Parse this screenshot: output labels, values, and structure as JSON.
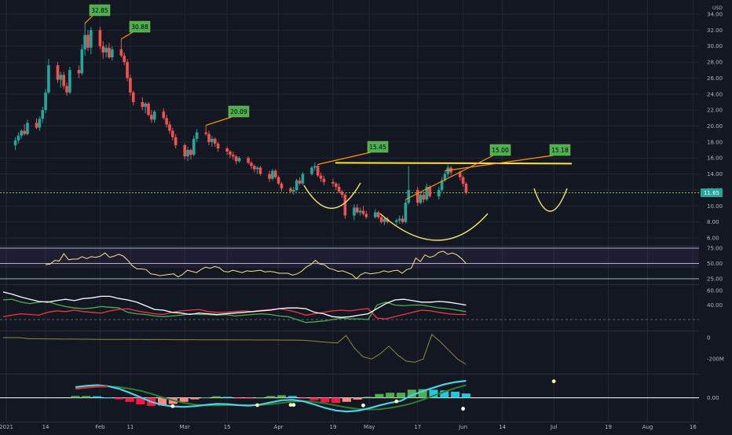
{
  "chart_data": {
    "type": "candlestick",
    "currency": "USD",
    "last_price": "11.65",
    "price_axis": {
      "min": 6,
      "max": 34,
      "ticks": [
        "34.00",
        "32.00",
        "30.00",
        "28.00",
        "26.00",
        "24.00",
        "22.00",
        "20.00",
        "18.00",
        "16.00",
        "14.00",
        "12.00",
        "10.00",
        "8.00",
        "6.00"
      ]
    },
    "x_ticks": [
      "2021",
      "14",
      "Feb",
      "11",
      "Mar",
      "15",
      "Apr",
      "19",
      "May",
      "17",
      "Jun",
      "14",
      "Jul",
      "19",
      "Aug",
      "16"
    ],
    "annotations": [
      "32.85",
      "30.88",
      "20.09",
      "15.45",
      "15.00",
      "15.18"
    ],
    "resistance_level": 15.4,
    "candles": [
      {
        "o": 17.6,
        "h": 18.6,
        "l": 17.0,
        "c": 18.2
      },
      {
        "o": 18.2,
        "h": 19.2,
        "l": 17.8,
        "c": 18.8
      },
      {
        "o": 18.8,
        "h": 19.6,
        "l": 18.4,
        "c": 19.4
      },
      {
        "o": 19.4,
        "h": 20.2,
        "l": 18.8,
        "c": 19.0
      },
      {
        "o": 19.0,
        "h": 20.8,
        "l": 18.8,
        "c": 20.4
      },
      {
        "o": 20.4,
        "h": 21.0,
        "l": 19.6,
        "c": 19.8
      },
      {
        "o": 19.8,
        "h": 21.2,
        "l": 19.4,
        "c": 20.9
      },
      {
        "o": 20.9,
        "h": 22.4,
        "l": 20.4,
        "c": 22.0
      },
      {
        "o": 22.0,
        "h": 24.6,
        "l": 21.6,
        "c": 24.2
      },
      {
        "o": 24.2,
        "h": 28.4,
        "l": 24.0,
        "c": 27.6
      },
      {
        "o": 27.6,
        "h": 28.0,
        "l": 25.4,
        "c": 25.8
      },
      {
        "o": 25.8,
        "h": 26.8,
        "l": 24.8,
        "c": 26.4
      },
      {
        "o": 26.4,
        "h": 26.8,
        "l": 24.6,
        "c": 25.0
      },
      {
        "o": 25.0,
        "h": 25.4,
        "l": 23.8,
        "c": 24.2
      },
      {
        "o": 24.2,
        "h": 27.4,
        "l": 24.0,
        "c": 27.0
      },
      {
        "o": 27.0,
        "h": 27.6,
        "l": 26.0,
        "c": 26.6
      },
      {
        "o": 26.6,
        "h": 30.2,
        "l": 26.4,
        "c": 29.6
      },
      {
        "o": 29.6,
        "h": 32.85,
        "l": 28.8,
        "c": 31.4
      },
      {
        "o": 31.4,
        "h": 32.0,
        "l": 29.4,
        "c": 29.8
      },
      {
        "o": 29.8,
        "h": 32.4,
        "l": 29.0,
        "c": 32.0
      },
      {
        "o": 32.0,
        "h": 32.4,
        "l": 29.6,
        "c": 30.0
      },
      {
        "o": 30.0,
        "h": 30.6,
        "l": 28.4,
        "c": 29.2
      },
      {
        "o": 29.2,
        "h": 30.2,
        "l": 28.6,
        "c": 29.8
      },
      {
        "o": 29.8,
        "h": 30.4,
        "l": 28.4,
        "c": 28.6
      },
      {
        "o": 28.6,
        "h": 30.0,
        "l": 28.2,
        "c": 29.6
      },
      {
        "o": 29.6,
        "h": 30.88,
        "l": 28.6,
        "c": 28.8
      },
      {
        "o": 28.8,
        "h": 29.2,
        "l": 27.6,
        "c": 28.0
      },
      {
        "o": 28.0,
        "h": 28.4,
        "l": 25.6,
        "c": 26.0
      },
      {
        "o": 26.0,
        "h": 26.4,
        "l": 23.8,
        "c": 24.2
      },
      {
        "o": 24.2,
        "h": 24.4,
        "l": 22.6,
        "c": 23.0
      },
      {
        "o": 23.0,
        "h": 23.6,
        "l": 22.0,
        "c": 22.4
      },
      {
        "o": 22.4,
        "h": 23.0,
        "l": 21.6,
        "c": 22.8
      },
      {
        "o": 22.8,
        "h": 23.0,
        "l": 21.2,
        "c": 21.4
      },
      {
        "o": 21.4,
        "h": 22.0,
        "l": 20.4,
        "c": 20.8
      },
      {
        "o": 20.8,
        "h": 22.0,
        "l": 20.4,
        "c": 21.8
      },
      {
        "o": 21.8,
        "h": 22.2,
        "l": 20.8,
        "c": 21.0
      },
      {
        "o": 21.0,
        "h": 21.4,
        "l": 19.8,
        "c": 20.2
      },
      {
        "o": 20.2,
        "h": 20.6,
        "l": 19.0,
        "c": 19.4
      },
      {
        "o": 19.4,
        "h": 19.8,
        "l": 18.2,
        "c": 18.6
      },
      {
        "o": 18.6,
        "h": 19.0,
        "l": 17.2,
        "c": 17.6
      },
      {
        "o": 17.6,
        "h": 17.8,
        "l": 15.8,
        "c": 16.2
      },
      {
        "o": 16.2,
        "h": 17.4,
        "l": 15.6,
        "c": 17.0
      },
      {
        "o": 17.0,
        "h": 17.2,
        "l": 15.8,
        "c": 16.4
      },
      {
        "o": 16.4,
        "h": 18.8,
        "l": 16.2,
        "c": 18.4
      },
      {
        "o": 18.4,
        "h": 19.6,
        "l": 18.0,
        "c": 19.2
      },
      {
        "o": 19.2,
        "h": 20.09,
        "l": 18.8,
        "c": 19.0
      },
      {
        "o": 19.0,
        "h": 19.4,
        "l": 17.6,
        "c": 18.0
      },
      {
        "o": 18.0,
        "h": 18.8,
        "l": 17.4,
        "c": 18.4
      },
      {
        "o": 18.4,
        "h": 18.6,
        "l": 17.4,
        "c": 17.8
      },
      {
        "o": 17.8,
        "h": 18.0,
        "l": 16.8,
        "c": 17.2
      },
      {
        "o": 17.2,
        "h": 17.4,
        "l": 16.4,
        "c": 16.8
      },
      {
        "o": 16.8,
        "h": 17.0,
        "l": 16.0,
        "c": 16.4
      },
      {
        "o": 16.4,
        "h": 16.8,
        "l": 15.8,
        "c": 16.2
      },
      {
        "o": 16.2,
        "h": 16.4,
        "l": 15.2,
        "c": 15.6
      },
      {
        "o": 15.6,
        "h": 16.2,
        "l": 15.4,
        "c": 16.0
      },
      {
        "o": 16.0,
        "h": 16.2,
        "l": 15.2,
        "c": 15.4
      },
      {
        "o": 15.4,
        "h": 15.6,
        "l": 14.6,
        "c": 15.0
      },
      {
        "o": 15.0,
        "h": 15.2,
        "l": 14.2,
        "c": 14.6
      },
      {
        "o": 14.6,
        "h": 15.0,
        "l": 14.0,
        "c": 14.8
      },
      {
        "o": 14.8,
        "h": 15.0,
        "l": 13.8,
        "c": 14.0
      },
      {
        "o": 14.0,
        "h": 14.4,
        "l": 13.0,
        "c": 13.4
      },
      {
        "o": 13.4,
        "h": 14.6,
        "l": 13.2,
        "c": 14.4
      },
      {
        "o": 14.4,
        "h": 14.6,
        "l": 13.4,
        "c": 13.6
      },
      {
        "o": 13.6,
        "h": 13.8,
        "l": 12.6,
        "c": 12.8
      },
      {
        "o": 12.8,
        "h": 13.0,
        "l": 11.8,
        "c": 12.2
      },
      {
        "o": 12.2,
        "h": 12.4,
        "l": 11.6,
        "c": 11.8
      },
      {
        "o": 11.8,
        "h": 12.4,
        "l": 11.4,
        "c": 12.0
      },
      {
        "o": 12.0,
        "h": 13.4,
        "l": 11.8,
        "c": 13.2
      },
      {
        "o": 13.2,
        "h": 13.6,
        "l": 12.6,
        "c": 12.8
      },
      {
        "o": 12.8,
        "h": 14.2,
        "l": 12.6,
        "c": 14.0
      },
      {
        "o": 14.0,
        "h": 15.0,
        "l": 13.8,
        "c": 14.8
      },
      {
        "o": 14.8,
        "h": 15.45,
        "l": 14.4,
        "c": 15.0
      },
      {
        "o": 15.0,
        "h": 15.2,
        "l": 13.6,
        "c": 13.8
      },
      {
        "o": 13.8,
        "h": 14.2,
        "l": 13.0,
        "c": 13.4
      },
      {
        "o": 13.4,
        "h": 13.8,
        "l": 12.6,
        "c": 13.0
      },
      {
        "o": 13.0,
        "h": 13.4,
        "l": 12.4,
        "c": 12.8
      },
      {
        "o": 12.8,
        "h": 13.0,
        "l": 12.0,
        "c": 12.4
      },
      {
        "o": 12.4,
        "h": 12.8,
        "l": 11.6,
        "c": 11.8
      },
      {
        "o": 11.8,
        "h": 12.0,
        "l": 11.0,
        "c": 11.4
      },
      {
        "o": 11.4,
        "h": 11.6,
        "l": 8.4,
        "c": 8.8
      },
      {
        "o": 8.8,
        "h": 10.2,
        "l": 8.2,
        "c": 9.8
      },
      {
        "o": 9.8,
        "h": 10.2,
        "l": 9.0,
        "c": 9.2
      },
      {
        "o": 9.2,
        "h": 9.8,
        "l": 8.8,
        "c": 9.4
      },
      {
        "o": 9.4,
        "h": 10.0,
        "l": 8.8,
        "c": 9.0
      },
      {
        "o": 9.0,
        "h": 9.4,
        "l": 8.4,
        "c": 8.6
      },
      {
        "o": 8.6,
        "h": 9.6,
        "l": 8.4,
        "c": 9.2
      },
      {
        "o": 9.2,
        "h": 9.4,
        "l": 8.4,
        "c": 8.6
      },
      {
        "o": 8.6,
        "h": 8.8,
        "l": 7.8,
        "c": 8.0
      },
      {
        "o": 8.0,
        "h": 8.6,
        "l": 7.6,
        "c": 8.4
      },
      {
        "o": 8.4,
        "h": 8.6,
        "l": 7.8,
        "c": 8.0
      },
      {
        "o": 8.0,
        "h": 8.4,
        "l": 7.6,
        "c": 8.2
      },
      {
        "o": 8.2,
        "h": 8.8,
        "l": 7.8,
        "c": 8.4
      },
      {
        "o": 8.4,
        "h": 8.8,
        "l": 7.8,
        "c": 8.0
      },
      {
        "o": 8.0,
        "h": 10.8,
        "l": 7.8,
        "c": 10.4
      },
      {
        "o": 10.4,
        "h": 15.0,
        "l": 10.2,
        "c": 12.0
      },
      {
        "o": 12.0,
        "h": 12.4,
        "l": 10.0,
        "c": 10.4
      },
      {
        "o": 10.4,
        "h": 11.8,
        "l": 10.2,
        "c": 11.4
      },
      {
        "o": 11.4,
        "h": 11.8,
        "l": 10.4,
        "c": 10.8
      },
      {
        "o": 10.8,
        "h": 12.8,
        "l": 10.6,
        "c": 12.4
      },
      {
        "o": 12.4,
        "h": 12.6,
        "l": 11.0,
        "c": 11.2
      },
      {
        "o": 11.2,
        "h": 12.4,
        "l": 10.8,
        "c": 12.0
      },
      {
        "o": 12.0,
        "h": 13.6,
        "l": 11.8,
        "c": 13.2
      },
      {
        "o": 13.2,
        "h": 14.4,
        "l": 13.0,
        "c": 14.0
      },
      {
        "o": 14.0,
        "h": 15.18,
        "l": 13.6,
        "c": 14.8
      },
      {
        "o": 14.8,
        "h": 15.0,
        "l": 13.8,
        "c": 14.2
      },
      {
        "o": 14.2,
        "h": 14.4,
        "l": 13.2,
        "c": 13.6
      },
      {
        "o": 13.6,
        "h": 13.8,
        "l": 12.4,
        "c": 12.8
      },
      {
        "o": 12.8,
        "h": 13.0,
        "l": 11.4,
        "c": 11.65
      }
    ],
    "rsi": {
      "levels": [
        "75.00",
        "50.00",
        "25.00"
      ],
      "values": [
        48,
        49,
        55,
        54,
        66,
        56,
        57,
        57,
        61,
        58,
        61,
        60,
        62,
        67,
        60,
        62,
        65,
        62,
        55,
        46,
        41,
        41,
        40,
        33,
        32,
        30,
        31,
        32,
        33,
        28,
        32,
        39,
        37,
        35,
        40,
        44,
        42,
        45,
        43,
        37,
        36,
        39,
        37,
        35,
        38,
        37,
        38,
        39,
        36,
        37,
        36,
        34,
        34,
        34,
        31,
        33,
        37,
        44,
        48,
        55,
        49,
        48,
        42,
        40,
        37,
        38,
        35,
        32,
        25,
        32,
        35,
        33,
        34,
        35,
        38,
        36,
        38,
        39,
        34,
        40,
        42,
        59,
        53,
        64,
        60,
        62,
        68,
        70,
        65,
        67,
        64,
        58,
        50
      ]
    },
    "dmi": {
      "levels": [
        "60.00",
        "40.00"
      ],
      "adx": [
        58,
        55,
        51,
        48,
        45,
        44,
        46,
        48,
        46,
        49,
        50,
        52,
        52,
        49,
        47,
        44,
        39,
        34,
        33,
        30,
        29,
        27,
        29,
        28,
        27,
        28,
        29,
        30,
        31,
        32,
        33,
        35,
        36,
        36,
        35,
        30,
        28,
        24,
        23,
        24,
        26,
        28,
        35,
        42,
        47,
        48,
        46,
        44,
        44,
        45,
        44,
        42,
        40
      ],
      "plus_di": [
        47,
        48,
        44,
        42,
        44,
        45,
        41,
        38,
        36,
        35,
        36,
        38,
        37,
        36,
        30,
        28,
        27,
        25,
        24,
        25,
        26,
        28,
        27,
        27,
        26,
        27,
        25,
        26,
        27,
        28,
        27,
        25,
        24,
        20,
        16,
        17,
        18,
        20,
        22,
        21,
        21,
        20,
        40,
        44,
        40,
        39,
        40,
        40,
        38,
        36,
        35,
        33,
        31
      ],
      "minus_di": [
        24,
        26,
        28,
        27,
        26,
        30,
        32,
        31,
        33,
        31,
        30,
        29,
        32,
        34,
        35,
        32,
        30,
        28,
        27,
        30,
        32,
        33,
        34,
        31,
        30,
        30,
        31,
        32,
        31,
        33,
        34,
        35,
        33,
        30,
        26,
        28,
        30,
        32,
        33,
        32,
        34,
        35,
        22,
        21,
        24,
        27,
        30,
        33,
        32,
        30,
        28,
        27,
        27
      ]
    },
    "volume_oscillator": {
      "levels": [
        "0",
        "-200M"
      ],
      "values": [
        0,
        0,
        0,
        -10,
        -10,
        -12,
        -12,
        -14,
        -14,
        -15,
        -15,
        -16,
        -16,
        -17,
        -16,
        -17,
        -17,
        -18,
        -18,
        -18,
        -19,
        -19,
        -19,
        -20,
        -20,
        -20,
        -20,
        -21,
        -21,
        -21,
        -22,
        -22,
        -22,
        -23,
        -23,
        -25,
        -30,
        -38,
        -45,
        -50,
        20,
        -100,
        -180,
        -200,
        -150,
        -80,
        -160,
        -220,
        -230,
        -200,
        30,
        -40,
        -120,
        -200,
        -250
      ]
    },
    "macd": {
      "levels": [
        "0.00"
      ],
      "macd_line": [
        4.2,
        4.7,
        5.0,
        4.6,
        3.6,
        2.0,
        0.2,
        -1.6,
        -2.8,
        -3.4,
        -3.6,
        -3.3,
        -2.8,
        -2.4,
        -2.5,
        -2.9,
        -3.1,
        -2.7,
        -1.8,
        -1.0,
        -0.8,
        -1.4,
        -2.6,
        -4.0,
        -5.0,
        -5.4,
        -5.1,
        -4.2,
        -3.0,
        -2.0,
        -1.2,
        1.0,
        2.6,
        4.0,
        5.3,
        6.2,
        6.7
      ],
      "signal_line": [
        3.5,
        4.0,
        4.4,
        4.5,
        4.2,
        3.6,
        2.8,
        1.6,
        0.2,
        -1.0,
        -2.0,
        -2.7,
        -3.0,
        -3.0,
        -2.9,
        -2.8,
        -2.9,
        -2.8,
        -2.5,
        -2.0,
        -1.5,
        -1.3,
        -1.6,
        -2.2,
        -3.0,
        -3.8,
        -4.4,
        -4.6,
        -4.5,
        -4.0,
        -3.2,
        -2.2,
        -0.8,
        0.8,
        2.4,
        3.8,
        5.0
      ],
      "histogram": [
        0.7,
        0.7,
        0.6,
        0.1,
        -0.6,
        -1.6,
        -2.6,
        -3.2,
        -3.0,
        -2.4,
        -1.6,
        -0.6,
        0.2,
        0.6,
        0.4,
        -0.1,
        -0.2,
        0.1,
        0.7,
        1.0,
        0.7,
        -0.1,
        -1.0,
        -1.8,
        -2.0,
        -1.6,
        -0.7,
        0.4,
        1.5,
        2.0,
        2.0,
        3.2,
        3.4,
        3.2,
        2.9,
        2.4,
        1.7
      ],
      "crossover_points": [
        [
          "2021-02-25",
          -3.3
        ],
        [
          "2021-03-25",
          -2.9
        ],
        [
          "2021-04-05",
          -2.8
        ],
        [
          "2021-04-06",
          -2.8
        ],
        [
          "2021-04-29",
          -3.0
        ],
        [
          "2021-05-10",
          -1.4
        ],
        [
          "2021-06-01",
          -4.3
        ],
        [
          "2021-07-01",
          6.5
        ]
      ]
    }
  }
}
